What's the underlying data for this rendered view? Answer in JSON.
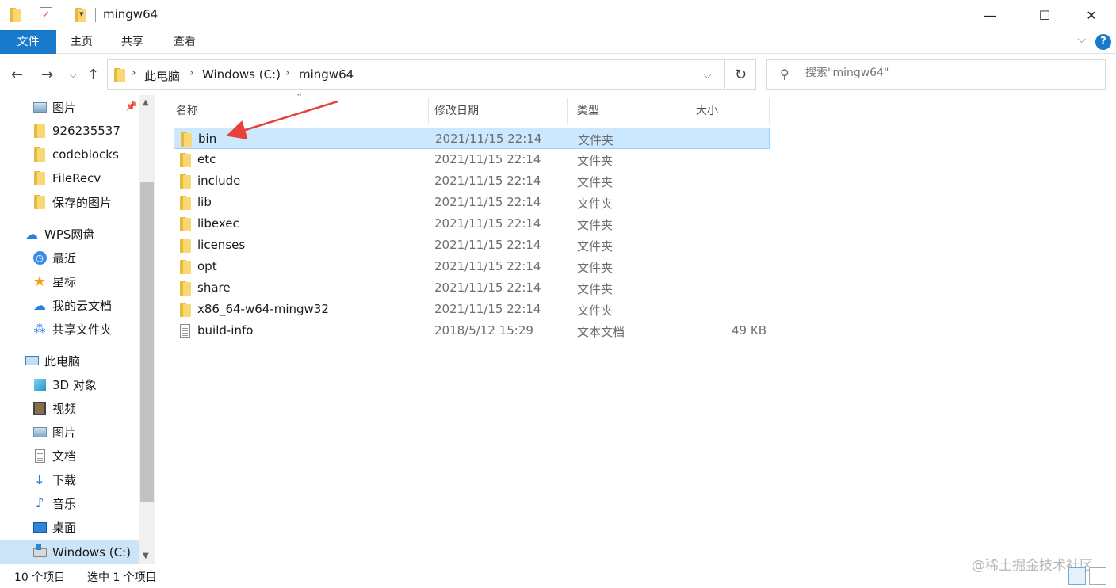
{
  "window": {
    "title": "mingw64",
    "minimize": "—",
    "maximize": "☐",
    "close": "✕"
  },
  "ribbon": {
    "tabs": [
      "文件",
      "主页",
      "共享",
      "查看"
    ],
    "help": "?"
  },
  "address": {
    "crumbs": [
      "此电脑",
      "Windows (C:)",
      "mingw64"
    ],
    "search_placeholder": "搜索\"mingw64\""
  },
  "sidebar": {
    "items": [
      {
        "label": "图片",
        "icon": "pictures-icon",
        "pinned": true
      },
      {
        "label": "926235537",
        "icon": "folder-icon"
      },
      {
        "label": "codeblocks",
        "icon": "folder-icon"
      },
      {
        "label": "FileRecv",
        "icon": "folder-icon"
      },
      {
        "label": "保存的图片",
        "icon": "folder-icon"
      },
      {
        "label": "WPS网盘",
        "icon": "cloud-icon"
      },
      {
        "label": "最近",
        "icon": "clock-icon"
      },
      {
        "label": "星标",
        "icon": "star-icon"
      },
      {
        "label": "我的云文档",
        "icon": "cloud-doc-icon"
      },
      {
        "label": "共享文件夹",
        "icon": "share-icon"
      },
      {
        "label": "此电脑",
        "icon": "computer-icon"
      },
      {
        "label": "3D 对象",
        "icon": "cube-icon"
      },
      {
        "label": "视频",
        "icon": "video-icon"
      },
      {
        "label": "图片",
        "icon": "pictures-icon"
      },
      {
        "label": "文档",
        "icon": "document-icon"
      },
      {
        "label": "下载",
        "icon": "download-icon"
      },
      {
        "label": "音乐",
        "icon": "music-icon"
      },
      {
        "label": "桌面",
        "icon": "desktop-icon"
      },
      {
        "label": "Windows (C:)",
        "icon": "drive-icon",
        "selected": true
      }
    ]
  },
  "columns": {
    "name": "名称",
    "date": "修改日期",
    "type": "类型",
    "size": "大小"
  },
  "files": [
    {
      "name": "bin",
      "date": "2021/11/15 22:14",
      "type": "文件夹",
      "size": "",
      "kind": "folder",
      "selected": true
    },
    {
      "name": "etc",
      "date": "2021/11/15 22:14",
      "type": "文件夹",
      "size": "",
      "kind": "folder"
    },
    {
      "name": "include",
      "date": "2021/11/15 22:14",
      "type": "文件夹",
      "size": "",
      "kind": "folder"
    },
    {
      "name": "lib",
      "date": "2021/11/15 22:14",
      "type": "文件夹",
      "size": "",
      "kind": "folder"
    },
    {
      "name": "libexec",
      "date": "2021/11/15 22:14",
      "type": "文件夹",
      "size": "",
      "kind": "folder"
    },
    {
      "name": "licenses",
      "date": "2021/11/15 22:14",
      "type": "文件夹",
      "size": "",
      "kind": "folder"
    },
    {
      "name": "opt",
      "date": "2021/11/15 22:14",
      "type": "文件夹",
      "size": "",
      "kind": "folder"
    },
    {
      "name": "share",
      "date": "2021/11/15 22:14",
      "type": "文件夹",
      "size": "",
      "kind": "folder"
    },
    {
      "name": "x86_64-w64-mingw32",
      "date": "2021/11/15 22:14",
      "type": "文件夹",
      "size": "",
      "kind": "folder"
    },
    {
      "name": "build-info",
      "date": "2018/5/12 15:29",
      "type": "文本文档",
      "size": "49 KB",
      "kind": "text"
    }
  ],
  "status": {
    "count": "10 个项目",
    "selected": "选中 1 个项目"
  },
  "watermark": "@稀土掘金技术社区",
  "colors": {
    "accent": "#1979ca",
    "selection": "#cce8ff",
    "annotation_arrow": "#e8413a"
  }
}
